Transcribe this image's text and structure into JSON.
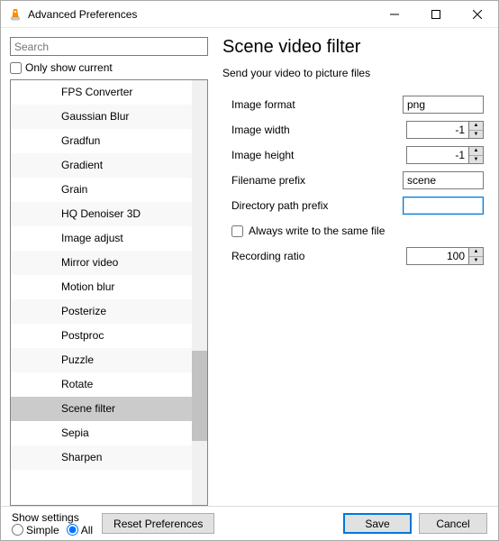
{
  "window": {
    "title": "Advanced Preferences"
  },
  "left": {
    "search_placeholder": "Search",
    "only_show_current_label": "Only show current",
    "only_show_current_checked": false,
    "tree_items": [
      {
        "label": "FPS Converter",
        "selected": false
      },
      {
        "label": "Gaussian Blur",
        "selected": false
      },
      {
        "label": "Gradfun",
        "selected": false
      },
      {
        "label": "Gradient",
        "selected": false
      },
      {
        "label": "Grain",
        "selected": false
      },
      {
        "label": "HQ Denoiser 3D",
        "selected": false
      },
      {
        "label": "Image adjust",
        "selected": false
      },
      {
        "label": "Mirror video",
        "selected": false
      },
      {
        "label": "Motion blur",
        "selected": false
      },
      {
        "label": "Posterize",
        "selected": false
      },
      {
        "label": "Postproc",
        "selected": false
      },
      {
        "label": "Puzzle",
        "selected": false
      },
      {
        "label": "Rotate",
        "selected": false
      },
      {
        "label": "Scene filter",
        "selected": true
      },
      {
        "label": "Sepia",
        "selected": false
      },
      {
        "label": "Sharpen",
        "selected": false
      }
    ]
  },
  "panel": {
    "title": "Scene video filter",
    "description": "Send your video to picture files",
    "image_format": {
      "label": "Image format",
      "value": "png"
    },
    "image_width": {
      "label": "Image width",
      "value": "-1"
    },
    "image_height": {
      "label": "Image height",
      "value": "-1"
    },
    "filename_prefix": {
      "label": "Filename prefix",
      "value": "scene"
    },
    "directory_prefix": {
      "label": "Directory path prefix",
      "value": ""
    },
    "always_write": {
      "label": "Always write to the same file",
      "checked": false
    },
    "recording_ratio": {
      "label": "Recording ratio",
      "value": "100"
    }
  },
  "footer": {
    "show_settings_label": "Show settings",
    "simple_label": "Simple",
    "all_label": "All",
    "selected_mode": "all",
    "reset_label": "Reset Preferences",
    "save_label": "Save",
    "cancel_label": "Cancel"
  }
}
